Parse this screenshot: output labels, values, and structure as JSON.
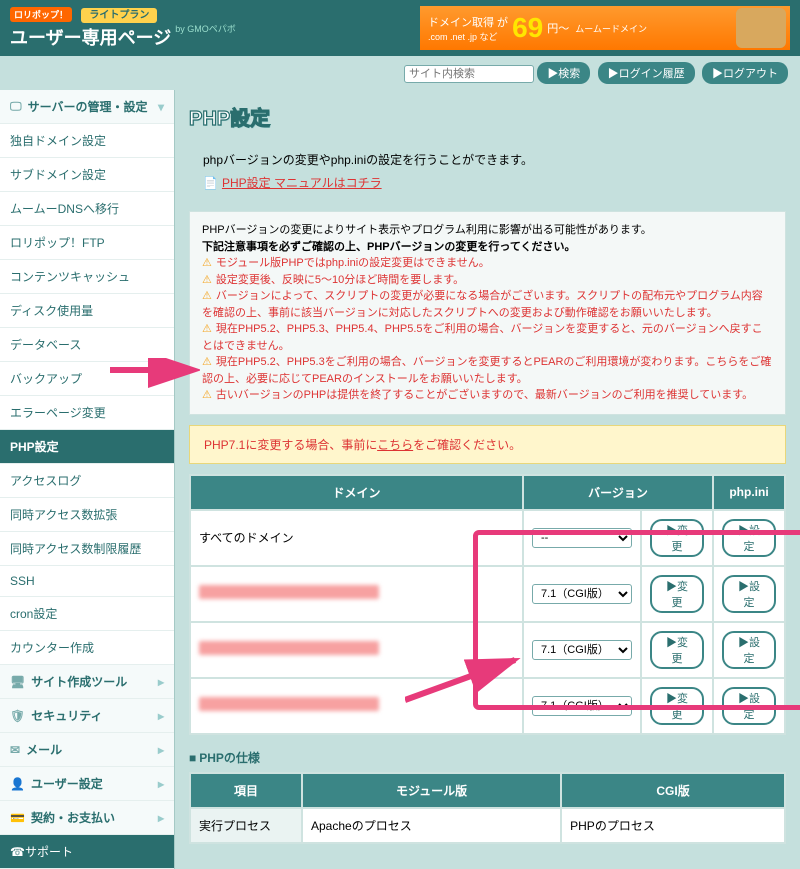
{
  "header": {
    "logo_tag": "ロリポップ！",
    "title": "ユーザー専用ページ",
    "byline": "by GMOペパボ",
    "plan": "ライトプラン"
  },
  "ad": {
    "line1": "ドメイン取得 が",
    "line2": ".com .net .jp など",
    "price": "69",
    "unit": "円〜",
    "brand": "ムームードメイン"
  },
  "toolbar": {
    "search_placeholder": "サイト内検索",
    "search_btn": "▶検索",
    "login_history": "▶ログイン履歴",
    "logout": "▶ログアウト"
  },
  "sidebar": {
    "group_server": "サーバーの管理・設定",
    "items": [
      "独自ドメイン設定",
      "サブドメイン設定",
      "ムームーDNSへ移行",
      "ロリポップ！FTP",
      "コンテンツキャッシュ",
      "ディスク使用量",
      "データベース",
      "バックアップ",
      "エラーページ変更",
      "PHP設定",
      "アクセスログ",
      "同時アクセス数拡張",
      "同時アクセス数制限履歴",
      "SSH",
      "cron設定",
      "カウンター作成"
    ],
    "group_site": "サイト作成ツール",
    "group_security": "セキュリティ",
    "group_mail": "メール",
    "group_user": "ユーザー設定",
    "group_contract": "契約・お支払い",
    "support": "サポート"
  },
  "page": {
    "title": "PHP設定",
    "intro": "phpバージョンの変更やphp.iniの設定を行うことができます。",
    "manual_link": "PHP設定 マニュアルはコチラ",
    "notice_lead1": "PHPバージョンの変更によりサイト表示やプログラム利用に影響が出る可能性があります。",
    "notice_lead2": "下記注意事項を必ずご確認の上、PHPバージョンの変更を行ってください。",
    "warnings": [
      "モジュール版PHPではphp.iniの設定変更はできません。",
      "設定変更後、反映に5〜10分ほど時間を要します。",
      "バージョンによって、スクリプトの変更が必要になる場合がございます。スクリプトの配布元やプログラム内容を確認の上、事前に該当バージョンに対応したスクリプトへの変更および動作確認をお願いいたします。",
      "現在PHP5.2、PHP5.3、PHP5.4、PHP5.5をご利用の場合、バージョンを変更すると、元のバージョンへ戻すことはできません。",
      "現在PHP5.2、PHP5.3をご利用の場合、バージョンを変更するとPEARのご利用環境が変わります。こちらをご確認の上、必要に応じてPEARのインストールをお願いいたします。",
      "古いバージョンのPHPは提供を終了することがございますので、最新バージョンのご利用を推奨しています。"
    ],
    "warning_link": "こちら",
    "alert71_pre": "PHP7.1に変更する場合、事前に",
    "alert71_link": "こちら",
    "alert71_post": "をご確認ください。"
  },
  "table": {
    "th_domain": "ドメイン",
    "th_version": "バージョン",
    "th_phpini": "php.ini",
    "all_domains": "すべてのドメイン",
    "versions": [
      "--",
      "7.1（CGI版）",
      "7.1（CGI版）",
      "7.1（CGI版）"
    ],
    "change_btn": "▶変 更",
    "set_btn": "▶設 定"
  },
  "spec": {
    "title": "PHPの仕様",
    "th_item": "項目",
    "th_module": "モジュール版",
    "th_cgi": "CGI版",
    "row_name": "実行プロセス",
    "row_module": "Apacheのプロセス",
    "row_cgi": "PHPのプロセス"
  }
}
